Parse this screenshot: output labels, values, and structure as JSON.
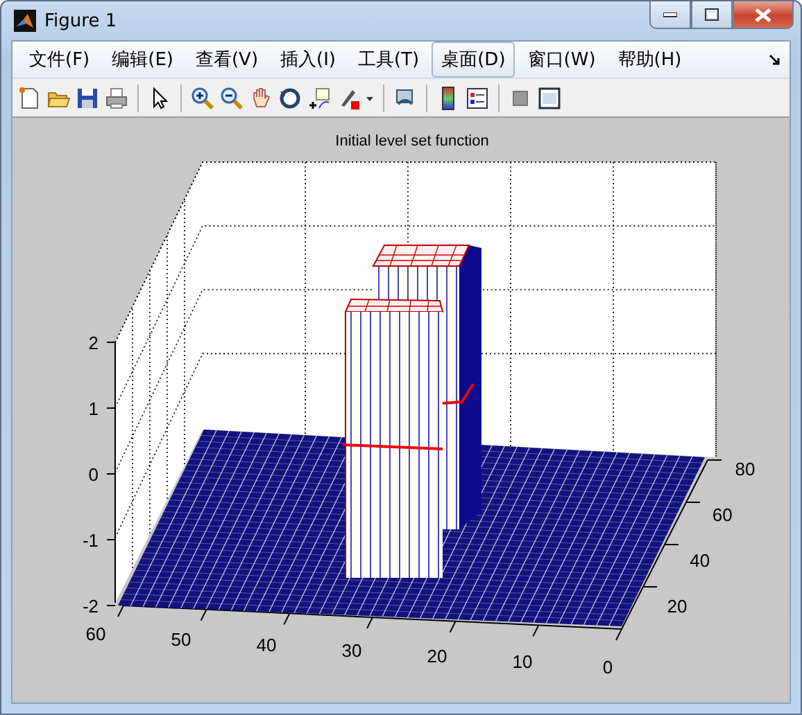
{
  "window": {
    "title": "Figure 1"
  },
  "menu": [
    {
      "label": "文件(F)",
      "selected": false
    },
    {
      "label": "编辑(E)",
      "selected": false
    },
    {
      "label": "查看(V)",
      "selected": false
    },
    {
      "label": "插入(I)",
      "selected": false
    },
    {
      "label": "工具(T)",
      "selected": false
    },
    {
      "label": "桌面(D)",
      "selected": true
    },
    {
      "label": "窗口(W)",
      "selected": false
    },
    {
      "label": "帮助(H)",
      "selected": false
    }
  ],
  "plot": {
    "title": "Initial level set function",
    "z_ticks": [
      "2",
      "1",
      "0",
      "-1",
      "-2"
    ],
    "x_ticks": [
      "60",
      "50",
      "40",
      "30",
      "20",
      "10",
      "0"
    ],
    "y_ticks": [
      "20",
      "40",
      "60",
      "80"
    ]
  }
}
